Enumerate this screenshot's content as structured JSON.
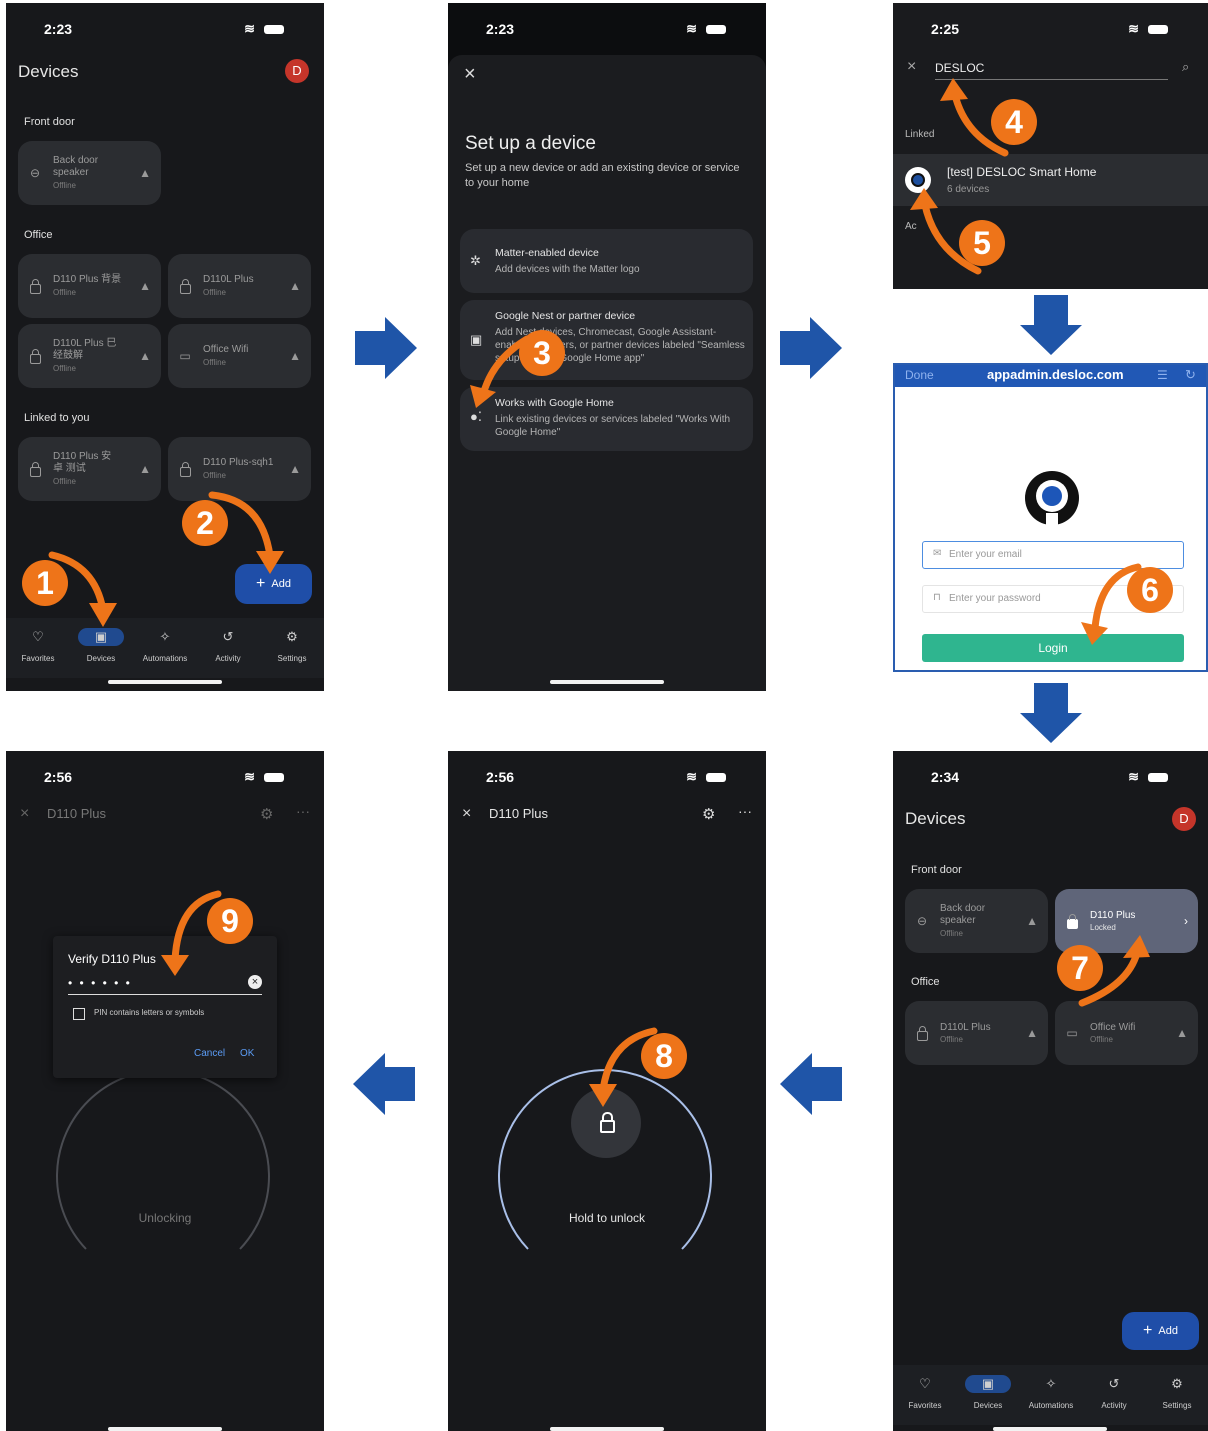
{
  "screens": {
    "s1": {
      "time": "2:23",
      "title": "Devices",
      "avatar": "D",
      "sections": [
        "Front door",
        "Office",
        "Linked to you"
      ],
      "tiles": [
        {
          "name": "Back door speaker",
          "status": "Offline"
        },
        {
          "name": "D110 Plus 背景",
          "status": "Offline"
        },
        {
          "name": "D110L Plus",
          "status": "Offline"
        },
        {
          "name": "D110L Plus 巳 经鼓解",
          "status": "Offline"
        },
        {
          "name": "Office Wifi",
          "status": "Offline"
        },
        {
          "name": "D110 Plus 安卓 测试",
          "status": "Offline"
        },
        {
          "name": "D110 Plus-sqh1",
          "status": "Offline"
        }
      ],
      "add_label": "Add",
      "nav": [
        "Favorites",
        "Devices",
        "Automations",
        "Activity",
        "Settings"
      ]
    },
    "s2": {
      "time": "2:23",
      "close": "×",
      "title": "Set up a device",
      "subtitle": "Set up a new device or add an existing device or service to your home",
      "cards": [
        {
          "title": "Matter-enabled device",
          "desc": "Add devices with the Matter logo"
        },
        {
          "title": "Google Nest or partner device",
          "desc": "Add Nest devices, Chromecast, Google Assistant-enabled speakers, or partner devices labeled \"Seamless setup with the Google Home app\""
        },
        {
          "title": "Works with Google Home",
          "desc": "Link existing devices or services labeled \"Works With Google Home\""
        }
      ]
    },
    "s3": {
      "time": "2:25",
      "search_value": "DESLOC",
      "linked_label": "Linked",
      "result_title": "[test] DESLOC Smart Home",
      "result_sub": "6 devices",
      "partial_label": "Ac"
    },
    "s4": {
      "done": "Done",
      "url": "appadmin.desloc.com",
      "email_placeholder": "Enter your email",
      "password_placeholder": "Enter your password",
      "login_label": "Login"
    },
    "s5": {
      "time": "2:34",
      "title": "Devices",
      "avatar": "D",
      "sections": [
        "Front door",
        "Office"
      ],
      "tiles": [
        {
          "name": "Back door speaker",
          "status": "Offline"
        },
        {
          "name": "D110 Plus",
          "status": "Locked"
        },
        {
          "name": "D110L Plus",
          "status": "Offline"
        },
        {
          "name": "Office Wifi",
          "status": "Offline"
        }
      ],
      "add_label": "Add",
      "nav": [
        "Favorites",
        "Devices",
        "Automations",
        "Activity",
        "Settings"
      ]
    },
    "s6": {
      "time": "2:56",
      "title": "D110 Plus",
      "hold_label": "Hold to unlock"
    },
    "s7": {
      "time": "2:56",
      "title": "D110 Plus",
      "dialog_title": "Verify D110 Plus",
      "pin_mask": "• • • • • •",
      "checkbox_label": "PIN contains letters or symbols",
      "cancel": "Cancel",
      "ok": "OK",
      "status_label": "Unlocking"
    }
  },
  "steps": [
    "1",
    "2",
    "3",
    "4",
    "5",
    "6",
    "7",
    "8",
    "9"
  ],
  "colors": {
    "orange": "#ee7419",
    "blue_arrow": "#1f55a8",
    "green": "#2fb58f",
    "fab": "#1f4ea8"
  }
}
